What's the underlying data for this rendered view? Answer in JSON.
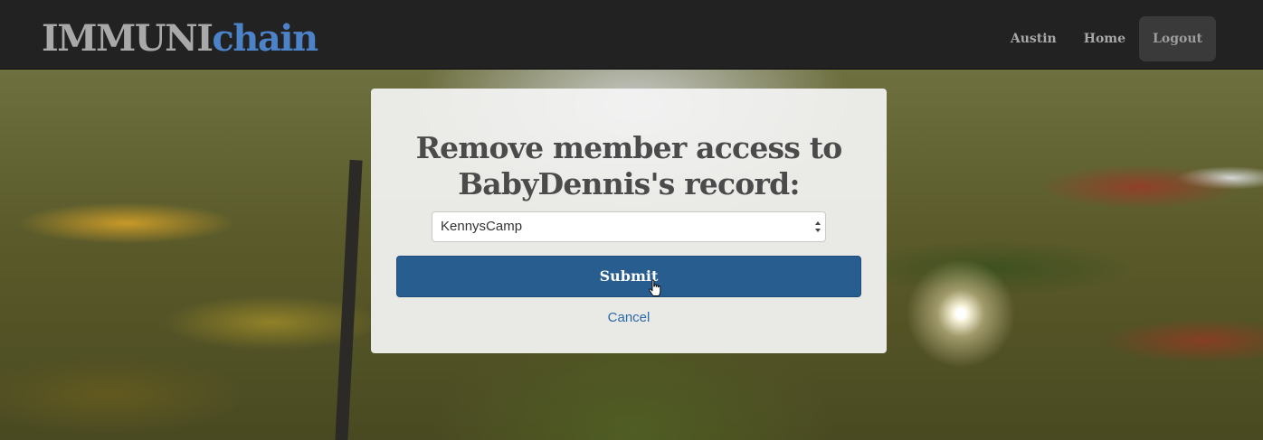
{
  "app": {
    "brand_part1": "IMMUNI",
    "brand_part2": "chain",
    "brand_colors": {
      "part1": "#a9a9a9",
      "part2": "#4b82c8"
    }
  },
  "nav": {
    "items": [
      {
        "label": "Austin",
        "active": false
      },
      {
        "label": "Home",
        "active": false
      },
      {
        "label": "Logout",
        "active": true
      }
    ]
  },
  "form": {
    "title_line1": "Remove member access to",
    "title_line2": "BabyDennis's record:",
    "select_value": "KennysCamp",
    "submit_label": "Submit",
    "cancel_label": "Cancel",
    "submit_color": "#285d8f",
    "link_color": "#2a6aa8"
  },
  "icons": {
    "select_arrows": "up-down-chevron-icon",
    "cursor": "hand-pointer-cursor-icon"
  }
}
